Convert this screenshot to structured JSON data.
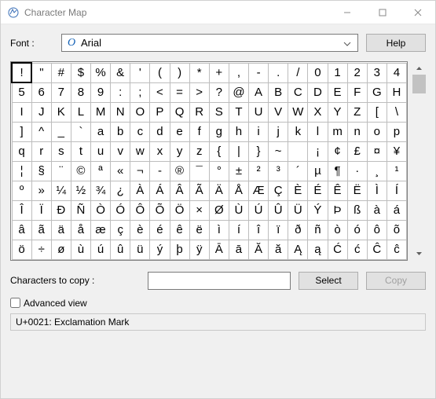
{
  "window": {
    "title": "Character Map"
  },
  "font_row": {
    "label": "Font :",
    "icon_glyph": "O",
    "font_name": "Arial"
  },
  "buttons": {
    "help": "Help",
    "select": "Select",
    "copy": "Copy"
  },
  "copy_row": {
    "label": "Characters to copy :",
    "value": ""
  },
  "advanced": {
    "label": "Advanced view",
    "checked": false
  },
  "status": "U+0021: Exclamation Mark",
  "grid": {
    "cols": 20,
    "selected_index": 0,
    "rows": [
      [
        "!",
        "\"",
        "#",
        "$",
        "%",
        "&",
        "'",
        "(",
        ")",
        "*",
        "+",
        ",",
        "-",
        ".",
        "/",
        "0",
        "1",
        "2",
        "3",
        "4"
      ],
      [
        "5",
        "6",
        "7",
        "8",
        "9",
        ":",
        ";",
        "<",
        "=",
        ">",
        "?",
        "@",
        "A",
        "B",
        "C",
        "D",
        "E",
        "F",
        "G",
        "H"
      ],
      [
        "I",
        "J",
        "K",
        "L",
        "M",
        "N",
        "O",
        "P",
        "Q",
        "R",
        "S",
        "T",
        "U",
        "V",
        "W",
        "X",
        "Y",
        "Z",
        "[",
        "\\"
      ],
      [
        "]",
        "^",
        "_",
        "`",
        "a",
        "b",
        "c",
        "d",
        "e",
        "f",
        "g",
        "h",
        "i",
        "j",
        "k",
        "l",
        "m",
        "n",
        "o",
        "p"
      ],
      [
        "q",
        "r",
        "s",
        "t",
        "u",
        "v",
        "w",
        "x",
        "y",
        "z",
        "{",
        "|",
        "}",
        "~",
        "",
        "¡",
        "¢",
        "£",
        "¤",
        "¥"
      ],
      [
        "¦",
        "§",
        "¨",
        "©",
        "ª",
        "«",
        "¬",
        "-",
        "®",
        "¯",
        "°",
        "±",
        "²",
        "³",
        "´",
        "µ",
        "¶",
        "·",
        "¸",
        "¹"
      ],
      [
        "º",
        "»",
        "¼",
        "½",
        "¾",
        "¿",
        "À",
        "Á",
        "Â",
        "Ã",
        "Ä",
        "Å",
        "Æ",
        "Ç",
        "È",
        "É",
        "Ê",
        "Ë",
        "Ì",
        "Í"
      ],
      [
        "Î",
        "Ï",
        "Đ",
        "Ñ",
        "Ò",
        "Ó",
        "Ô",
        "Õ",
        "Ö",
        "×",
        "Ø",
        "Ù",
        "Ú",
        "Û",
        "Ü",
        "Ý",
        "Þ",
        "ß",
        "à",
        "á"
      ],
      [
        "â",
        "ã",
        "ä",
        "å",
        "æ",
        "ç",
        "è",
        "é",
        "ê",
        "ë",
        "ì",
        "í",
        "î",
        "ï",
        "ð",
        "ñ",
        "ò",
        "ó",
        "ô",
        "õ"
      ],
      [
        "ö",
        "÷",
        "ø",
        "ù",
        "ú",
        "û",
        "ü",
        "ý",
        "þ",
        "ÿ",
        "Ā",
        "ā",
        "Ă",
        "ă",
        "Ą",
        "ą",
        "Ć",
        "ć",
        "Ĉ",
        "ĉ"
      ]
    ]
  }
}
